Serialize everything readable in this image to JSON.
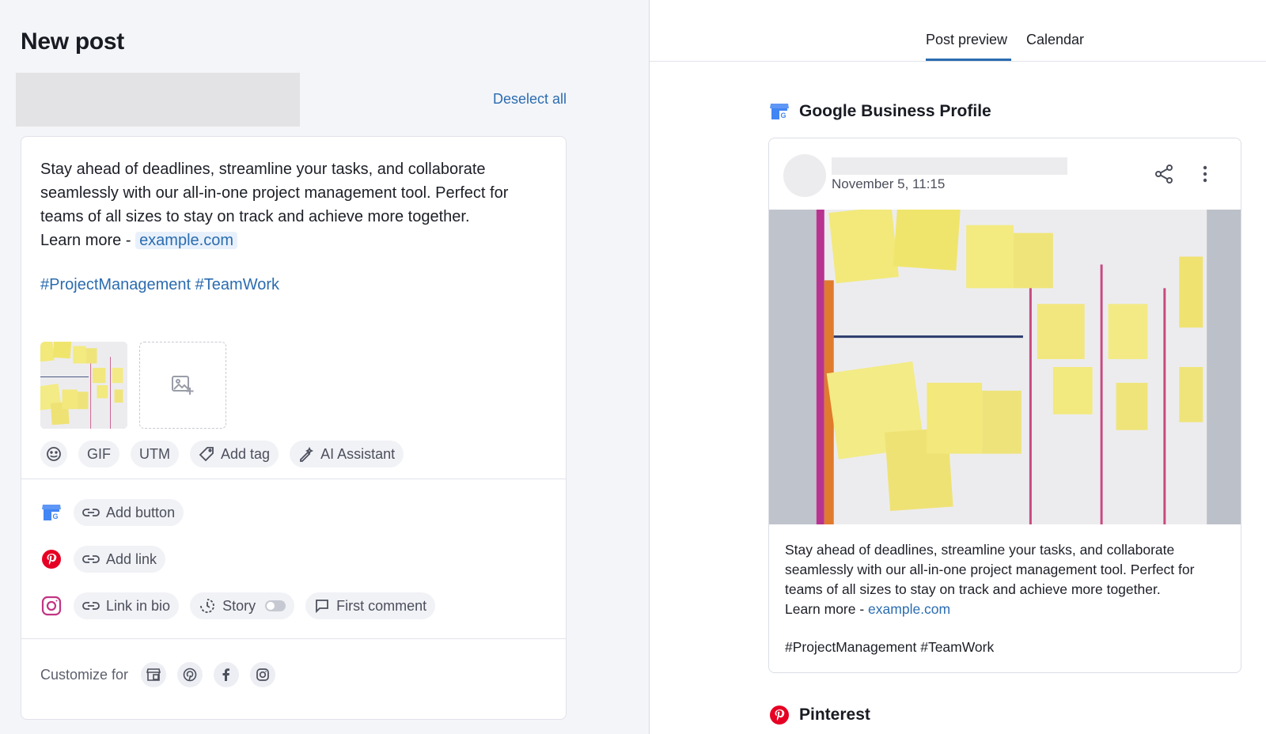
{
  "left": {
    "title": "New post",
    "deselect_all": "Deselect all",
    "post_text": "Stay ahead of deadlines, streamline your tasks, and collaborate seamlessly with our all-in-one project management tool. Perfect for teams of all sizes to stay on track and achieve more together.",
    "learn_more_prefix": "Learn more - ",
    "link": "example.com",
    "hashtags": "#ProjectManagement #TeamWork",
    "toolbar": {
      "emoji_icon": "smiley-icon",
      "gif": "GIF",
      "utm": "UTM",
      "add_tag": "Add tag",
      "ai_assistant": "AI Assistant"
    },
    "networks": {
      "google": {
        "icon": "google-business-icon",
        "action": "Add button"
      },
      "pinterest": {
        "icon": "pinterest-icon",
        "action": "Add link"
      },
      "instagram": {
        "icon": "instagram-icon",
        "link_in_bio": "Link in bio",
        "story": "Story",
        "first_comment": "First comment"
      }
    },
    "customize_label": "Customize for"
  },
  "right": {
    "tabs": [
      "Post preview",
      "Calendar"
    ],
    "active_tab": "Post preview",
    "google_section": "Google Business Profile",
    "preview": {
      "date": "November 5, 11:15",
      "text": "Stay ahead of deadlines, streamline your tasks, and collaborate seamlessly with our all-in-one project management tool. Perfect for teams of all sizes to stay on track and achieve more together.",
      "learn_more_prefix": "Learn more - ",
      "link": "example.com",
      "hashtags": "#ProjectManagement #TeamWork"
    },
    "pinterest_section": "Pinterest"
  },
  "colors": {
    "accent": "#2b6cb0",
    "pinterest": "#e60023",
    "google_blue": "#4285f4",
    "instagram": "#c13584"
  }
}
